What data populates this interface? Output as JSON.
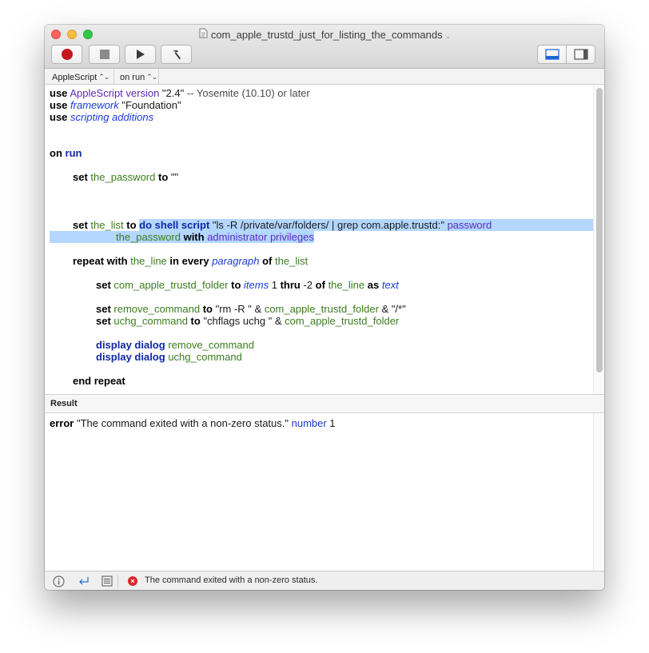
{
  "window": {
    "title": "com_apple_trustd_just_for_listing_the_commands",
    "title_chevron": "⌄",
    "doc_icon": "script-doc-icon"
  },
  "toolbar": {
    "record_icon": "record-icon",
    "stop_icon": "stop-icon",
    "run_icon": "play-icon",
    "compile_icon": "hammer-icon",
    "view_toggle": [
      "bottom-panel-icon",
      "side-panel-icon"
    ]
  },
  "navbar": {
    "language": "AppleScript",
    "handler": "on run"
  },
  "code": {
    "l1": {
      "use": "use",
      "app": "AppleScript version",
      "rest": " \"2.4\" ",
      "comment": "-- Yosemite (10.10) or later"
    },
    "l2": {
      "use": "use",
      "cls": "framework",
      "rest": " \"Foundation\""
    },
    "l3": {
      "use": "use",
      "cls": "scripting additions"
    },
    "l4": {
      "on": "on",
      "run": "run"
    },
    "l5": {
      "set": "set",
      "var": "the_password",
      "to": "to",
      "rest": " \"\""
    },
    "l6": {
      "set": "set",
      "var": "the_list",
      "to": "to",
      "cmd": "do shell script",
      "str": " \"ls -R /private/var/folders/ | grep com.apple.trustd:\" ",
      "prop": "password"
    },
    "l7": {
      "var": "the_password",
      "with": "with",
      "prop": "administrator privileges"
    },
    "l8": {
      "repeat": "repeat with",
      "var1": "the_line",
      "in": "in every",
      "cls": "paragraph",
      "of": "of",
      "var2": "the_list"
    },
    "l9": {
      "set": "set",
      "var1": "com_apple_trustd_folder",
      "to": "to",
      "cls1": "items",
      "n1": " 1 ",
      "thru": "thru",
      "n2": " -2 ",
      "of": "of",
      "var2": "the_line",
      "as": "as",
      "cls2": "text"
    },
    "l10": {
      "set": "set",
      "var1": "remove_command",
      "to": "to",
      "str1": " \"rm -R \" & ",
      "var2": "com_apple_trustd_folder",
      "str2": " & \"/*\""
    },
    "l11": {
      "set": "set",
      "var1": "uchg_command",
      "to": "to",
      "str1": " \"chflags uchg \" & ",
      "var2": "com_apple_trustd_folder"
    },
    "l12": {
      "cmd": "display dialog",
      "var": "remove_command"
    },
    "l13": {
      "cmd": "display dialog",
      "var": "uchg_command"
    },
    "l14": {
      "end": "end repeat"
    }
  },
  "result": {
    "header": "Result",
    "error_kw": "error",
    "message": " \"The command exited with a non-zero status.\" ",
    "number_kw": "number",
    "number_val": " 1"
  },
  "statusbar": {
    "message": "The command exited with a non-zero status.",
    "error_glyph": "×"
  },
  "colors": {
    "keyword": "#000000",
    "command": "#1027a6",
    "variable": "#3b7d1c",
    "class": "#1b3bd6",
    "property": "#5a2dc0",
    "selection": "#b3d7ff",
    "error": "#d9262b"
  }
}
